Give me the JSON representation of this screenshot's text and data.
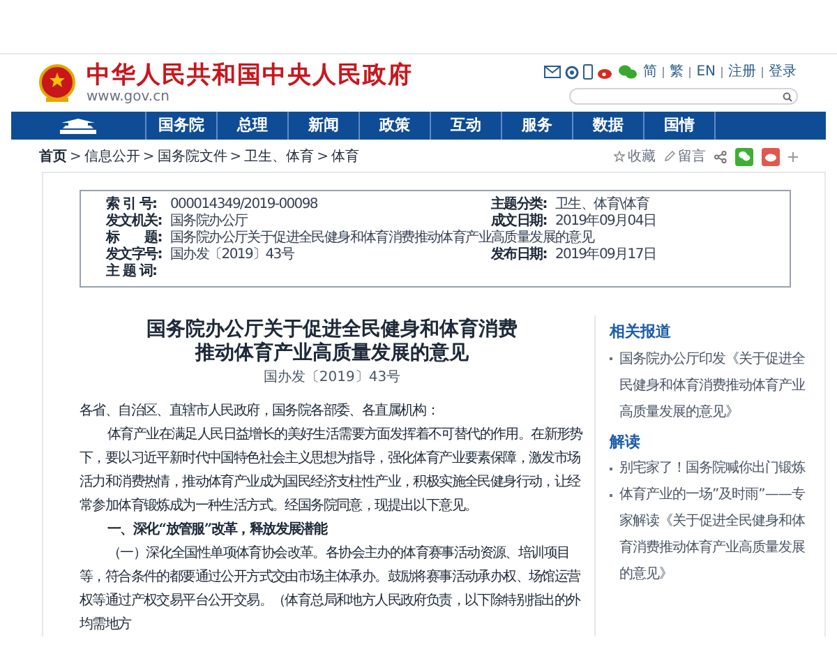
{
  "header": {
    "site_name": "中华人民共和国中央人民政府",
    "domain": "www.gov.cn",
    "links": [
      "简",
      "繁",
      "EN",
      "注册",
      "登录"
    ]
  },
  "nav": {
    "items": [
      {
        "label": "国务院"
      },
      {
        "label": "总理"
      },
      {
        "label": "新闻"
      },
      {
        "label": "政策"
      },
      {
        "label": "互动"
      },
      {
        "label": "服务"
      },
      {
        "label": "数据"
      },
      {
        "label": "国情"
      }
    ]
  },
  "breadcrumb": {
    "separator": ">",
    "items": [
      "首页",
      "信息公开",
      "国务院文件",
      "卫生、体育",
      "体育"
    ]
  },
  "actions": [
    "收藏",
    "留言"
  ],
  "meta": [
    {
      "label": "索 引 号:",
      "value": "000014349/2019-00098",
      "label2": "主题分类:",
      "value2": "卫生、体育\\体育"
    },
    {
      "label": "发文机关:",
      "value": "国务院办公厅",
      "label2": "成文日期:",
      "value2": "2019年09月04日"
    },
    {
      "label": "标　　题:",
      "value": "国务院办公厅关于促进全民健身和体育消费推动体育产业高质量发展的意见"
    },
    {
      "label": "发文字号:",
      "value": "国办发〔2019〕43号",
      "label2": "发布日期:",
      "value2": "2019年09月17日"
    },
    {
      "label": "主 题 词:"
    }
  ],
  "article": {
    "title": [
      "国务院办公厅关于促进全民健身和体育消费",
      "推动体育产业高质量发展的意见"
    ],
    "doc_number": "国办发〔2019〕43号",
    "paragraphs": [
      {
        "kind": "salutation",
        "text": "各省、自治区、直辖市人民政府，国务院各部委、各直属机构："
      },
      {
        "kind": "body",
        "text": "体育产业在满足人民日益增长的美好生活需要方面发挥着不可替代的作用。在新形势下，要以习近平新时代中国特色社会主义思想为指导，强化体育产业要素保障，激发市场活力和消费热情，推动体育产业成为国民经济支柱性产业，积极实施全民健身行动，让经常参加体育锻炼成为一种生活方式。经国务院同意，现提出以下意见。"
      },
      {
        "kind": "heading",
        "text": "一、深化“放管服”改革，释放发展潜能"
      },
      {
        "kind": "body",
        "text": "（一）深化全国性单项体育协会改革。各协会主办的体育赛事活动资源、培训项目等，符合条件的都要通过公开方式交由市场主体承办。鼓励将赛事活动承办权、场馆运营权等通过产权交易平台公开交易。（体育总局和地方人民政府负责，以下除特别指出的外均需地方"
      }
    ]
  },
  "sidebar": [
    {
      "heading": "相关报道",
      "items": [
        "国务院办公厅印发《关于促进全民健身和体育消费推动体育产业高质量发展的意见》"
      ]
    },
    {
      "heading": "解读",
      "items": [
        "别宅家了！国务院喊你出门锻炼",
        "体育产业的一场”及时雨”——专家解读《关于促进全民健身和体育消费推动体育产业高质量发展的意见》"
      ]
    }
  ]
}
